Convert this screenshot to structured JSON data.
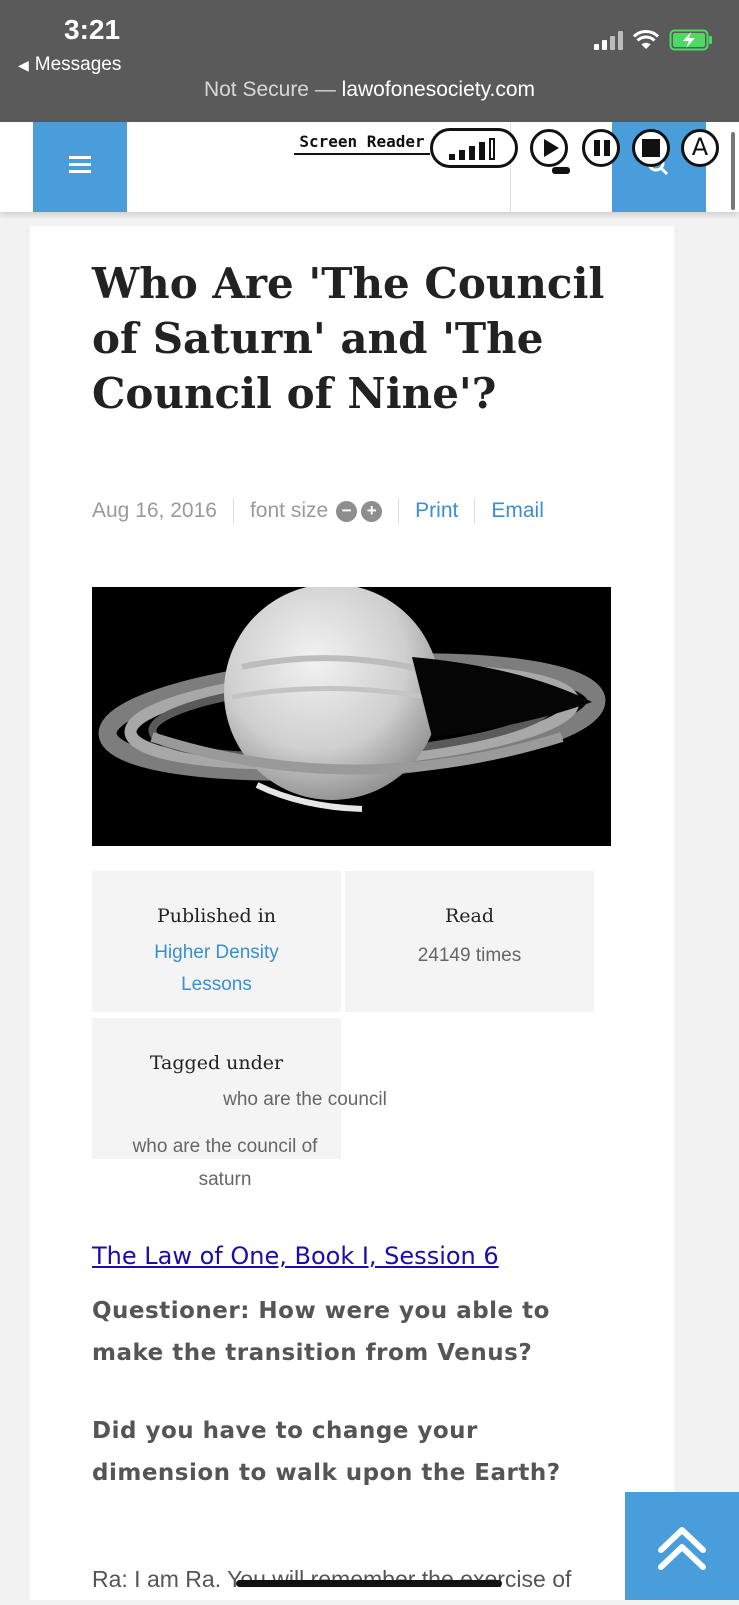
{
  "status_bar": {
    "time": "3:21",
    "back_app": "Messages"
  },
  "address_bar": {
    "security": "Not Secure —",
    "domain": "lawofonesociety.com"
  },
  "screen_reader": {
    "label": "Screen Reader",
    "icons": [
      "volume-icon",
      "play-icon",
      "pause-icon",
      "stop-icon",
      "font-a-icon"
    ]
  },
  "article": {
    "title": "Who Are 'The Council of Saturn' and 'The Council of Nine'?",
    "date": "Aug 16, 2016",
    "font_size_label": "font size",
    "decrease_label": "−",
    "increase_label": "+",
    "print_label": "Print",
    "email_label": "Email",
    "published_in_label": "Published in",
    "category": "Higher Density Lessons",
    "read_label": "Read",
    "read_count": "24149 times",
    "tagged_label": "Tagged under",
    "tags": [
      "who are the council",
      "who are the council of saturn"
    ],
    "session_link": "The Law of One, Book I, Session 6",
    "question_1": "Questioner: How were you able to make the transition from Venus?",
    "question_2": "Did you have to change your dimension to walk upon the Earth?",
    "answer_start": "Ra: I am Ra. You will remember the exercise of"
  },
  "colors": {
    "accent": "#4a9ddb",
    "link": "#3b8fd0",
    "status_bar": "#5a5a5a"
  }
}
